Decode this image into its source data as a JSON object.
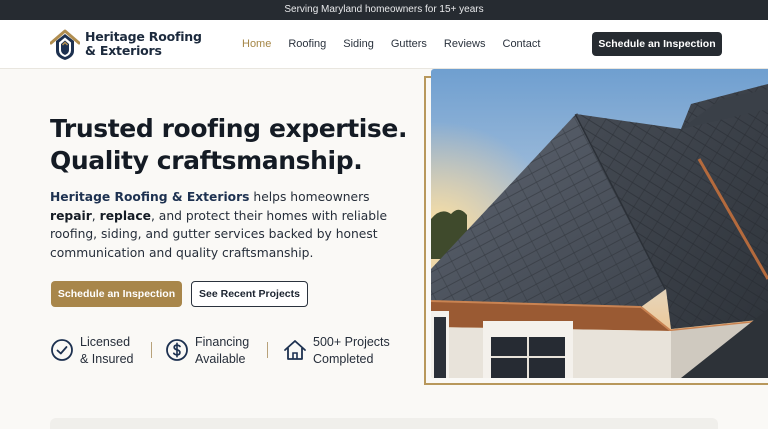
{
  "topbar": {
    "text": "Serving Maryland homeowners for 15+ years"
  },
  "header": {
    "logo": {
      "line1": "Heritage Roofing",
      "line2": "& Exteriors",
      "icon": "house-shield-logo"
    },
    "nav": [
      {
        "label": "Home",
        "active": true
      },
      {
        "label": "Roofing",
        "active": false
      },
      {
        "label": "Siding",
        "active": false
      },
      {
        "label": "Gutters",
        "active": false
      },
      {
        "label": "Reviews",
        "active": false
      },
      {
        "label": "Contact",
        "active": false
      }
    ],
    "cta_label": "Schedule an Inspection"
  },
  "hero": {
    "title_line1": "Trusted roofing expertise.",
    "title_line2": "Quality craftsmanship.",
    "description": {
      "brand": "Heritage Roofing & Exteriors",
      "part1": " helps homeowners ",
      "bold1": "repair",
      "part2": ", ",
      "bold2": "replace",
      "part3": ", and protect their homes with reliable roofing, siding, and gutter services backed by honest communication and quality craftsmanship."
    },
    "primary_button": "Schedule an Inspection",
    "secondary_button": "See Recent Projects",
    "image_alt": "slate-roof-sunset-photo"
  },
  "badges": [
    {
      "icon": "check-circle-icon",
      "line1": "Licensed",
      "line2": "& Insured"
    },
    {
      "icon": "dollar-circle-icon",
      "line1": "Financing",
      "line2": "Available"
    },
    {
      "icon": "house-icon",
      "line1": "500+ Projects",
      "line2": "Completed"
    }
  ],
  "colors": {
    "accent_gold": "#a8864a",
    "dark": "#262b31",
    "navy": "#1d3150",
    "background": "#faf9f6"
  }
}
